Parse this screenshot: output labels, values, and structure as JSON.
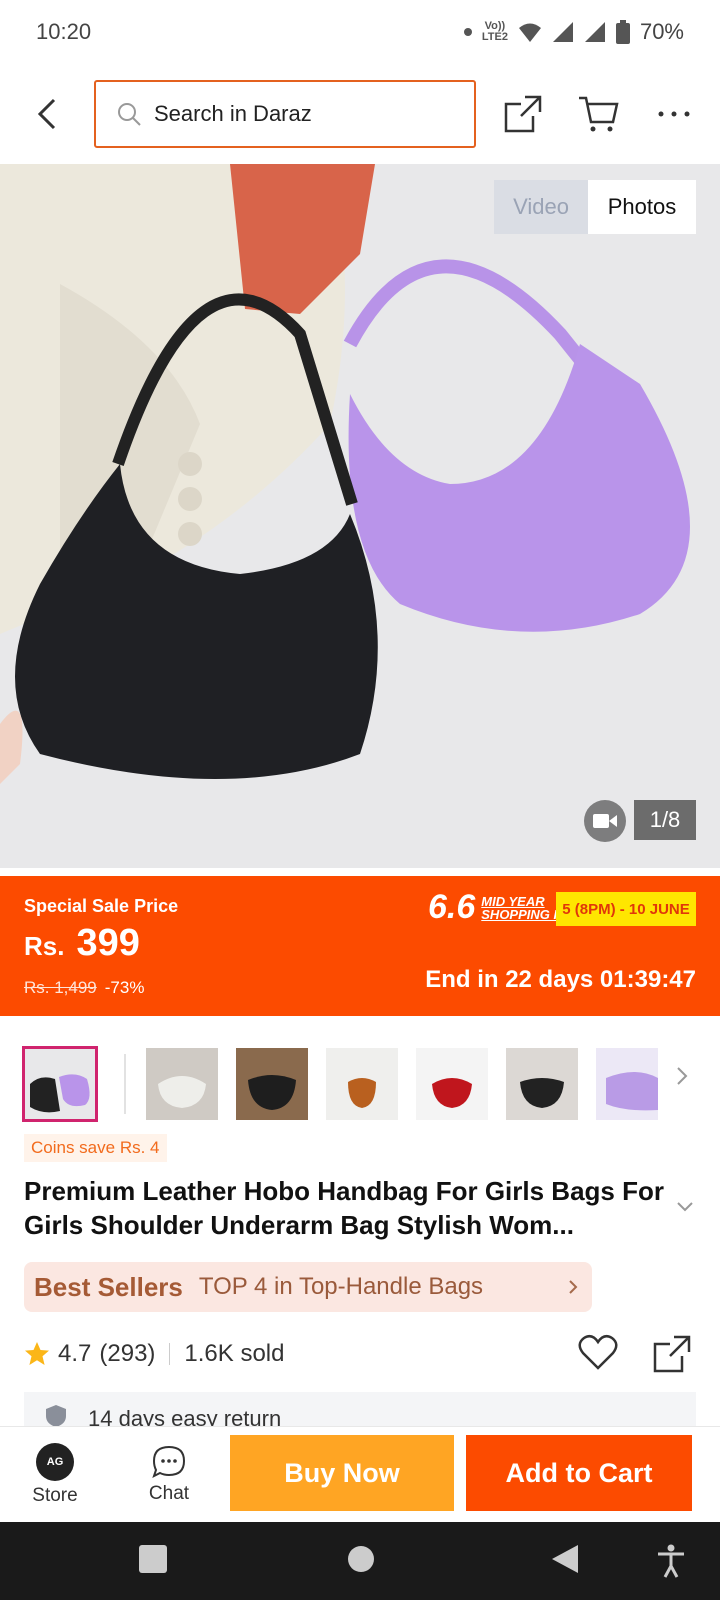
{
  "status_bar": {
    "time": "10:20",
    "volte": "Vo)) LTE2",
    "battery": "70%"
  },
  "search": {
    "placeholder": "Search in Daraz"
  },
  "media": {
    "video_label": "Video",
    "photos_label": "Photos",
    "counter": "1/8"
  },
  "price": {
    "special_label": "Special Sale Price",
    "currency": "Rs.",
    "current": "399",
    "original": "Rs. 1,499",
    "discount": "-73%",
    "event_big": "6.6",
    "event_small_1": "MID YEAR",
    "event_small_2": "SHOPPING FEST!",
    "event_dates": "5 (8PM) - 10 JUNE",
    "countdown": "End in 22 days 01:39:47"
  },
  "coins_badge": "Coins save Rs. 4",
  "product": {
    "title": "Premium Leather Hobo Handbag For Girls Bags For Girls Shoulder Underarm Bag Stylish Wom..."
  },
  "best_sellers": {
    "brand": "Best Sellers",
    "text": "TOP 4 in Top-Handle Bags"
  },
  "rating": {
    "score": "4.7",
    "count": "(293)",
    "sold": "1.6K sold"
  },
  "return_policy": "14 days easy return",
  "action_bar": {
    "store": "Store",
    "store_avatar": "AG",
    "chat": "Chat",
    "buy_now": "Buy Now",
    "add_to_cart": "Add to Cart"
  },
  "thumbnails": [
    {
      "name": "black-and-purple",
      "color": "#2a2a2a"
    },
    {
      "name": "white",
      "color": "#eeeeea"
    },
    {
      "name": "black",
      "color": "#1e1e1e"
    },
    {
      "name": "brown",
      "color": "#b9601f"
    },
    {
      "name": "red",
      "color": "#c0161d"
    },
    {
      "name": "black-on-stand",
      "color": "#222222"
    },
    {
      "name": "purple",
      "color": "#b99be6"
    }
  ],
  "colors": {
    "brand_orange": "#fc4b00",
    "buy_now": "#ffa523",
    "search_border": "#e4611f"
  }
}
